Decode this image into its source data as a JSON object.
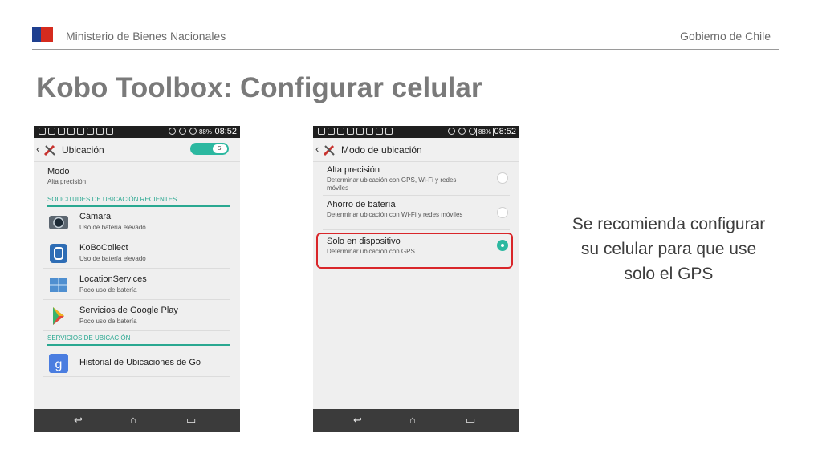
{
  "header": {
    "ministry": "Ministerio de Bienes Nacionales",
    "government": "Gobierno de Chile",
    "flag_colors": {
      "blue": "#1f3f8f",
      "red": "#d52b1e"
    }
  },
  "title": "Kobo Toolbox: Configurar celular",
  "phone_a": {
    "status": {
      "battery": "88%",
      "time": "08:52"
    },
    "appbar": {
      "title": "Ubicación",
      "toggle_label": "SÍ"
    },
    "mode": {
      "title": "Modo",
      "value": "Alta precisión"
    },
    "section_recent": "SOLICITUDES DE UBICACIÓN RECIENTES",
    "apps": [
      {
        "name": "Cámara",
        "sub": "Uso de batería elevado",
        "icon": "camera-icon"
      },
      {
        "name": "KoBoCollect",
        "sub": "Uso de batería elevado",
        "icon": "kobocollect-icon"
      },
      {
        "name": "LocationServices",
        "sub": "Poco uso de batería",
        "icon": "location-services-icon"
      },
      {
        "name": "Servicios de Google Play",
        "sub": "Poco uso de batería",
        "icon": "google-play-icon"
      }
    ],
    "section_services": "SERVICIOS DE UBICACIÓN",
    "history": {
      "name": "Historial de Ubicaciones de Go"
    }
  },
  "phone_b": {
    "status": {
      "battery": "88%",
      "time": "08:52"
    },
    "appbar": {
      "title": "Modo de ubicación"
    },
    "options": [
      {
        "title": "Alta precisión",
        "sub": "Determinar ubicación con GPS, Wi-Fi y redes móviles",
        "selected": false
      },
      {
        "title": "Ahorro de batería",
        "sub": "Determinar ubicación con Wi-Fi y redes móviles",
        "selected": false
      },
      {
        "title": "Solo en dispositivo",
        "sub": "Determinar ubicación con GPS",
        "selected": true
      }
    ],
    "highlight_color": "#d9262a"
  },
  "caption": "Se recomienda configurar su celular para que use solo el GPS",
  "accent": "#2cb8a0"
}
